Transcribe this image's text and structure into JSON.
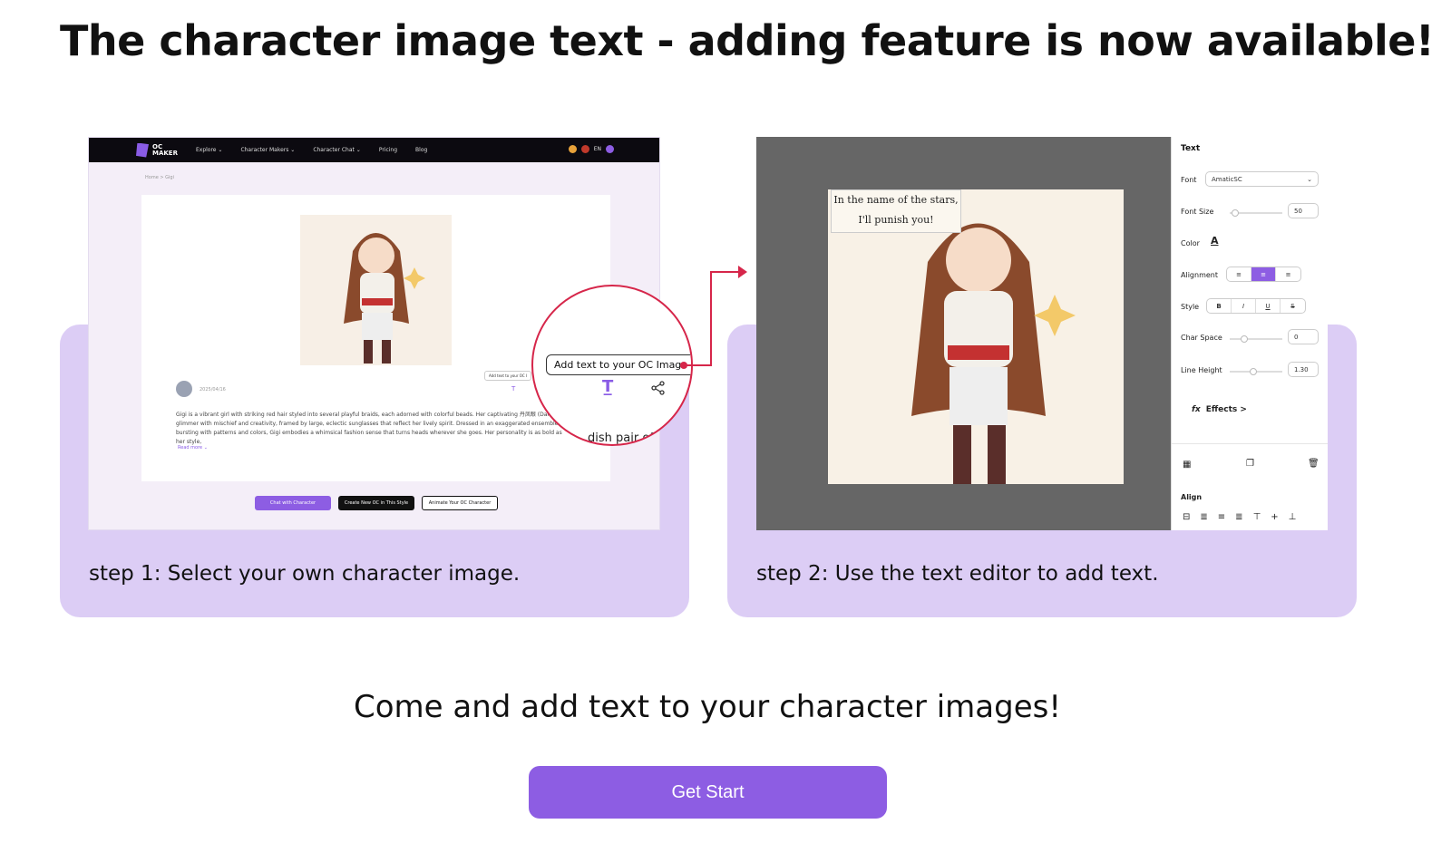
{
  "headline": "The character image text - adding feature is now available!",
  "steps": [
    {
      "caption": "step 1: Select your own character image."
    },
    {
      "caption": "step 2: Use the text editor to add text."
    }
  ],
  "site": {
    "logo": "OC\nMAKER",
    "nav": [
      "Explore ⌄",
      "Character Makers ⌄",
      "Character Chat ⌄",
      "Pricing",
      "Blog"
    ],
    "lang": "EN",
    "breadcrumb": "Home  >  Gigi",
    "date": "2025/04/16",
    "bio": "Gigi is a vibrant girl with striking red hair styled into several playful braids, each adorned with colorful beads. Her captivating 丹凤眼 (Danfeng) glimmer with mischief and creativity, framed by large, eclectic sunglasses that reflect her lively spirit. Dressed in an exaggerated ensemble bursting with patterns and colors, Gigi embodies a whimsical fashion sense that turns heads wherever she goes. Her personality is as bold as her style,",
    "read_more": "Read more ⌄",
    "mini_pill": "Add text to your OC I",
    "buttons": [
      "Chat with Character",
      "Create New OC in This Style",
      "Animate Your OC Character"
    ]
  },
  "zoom": {
    "pill": "Add text to your OC Image",
    "peek": "dish pair of"
  },
  "editor": {
    "canvas_text": [
      "In the name of the stars,",
      "I'll punish you!"
    ],
    "panel_title": "Text",
    "font_label": "Font",
    "font_value": "AmaticSC",
    "font_size_label": "Font Size",
    "font_size_value": "50",
    "color_label": "Color",
    "color_glyph": "A",
    "alignment_label": "Alignment",
    "style_label": "Style",
    "style_buttons": [
      "B",
      "I",
      "U",
      "S"
    ],
    "char_space_label": "Char Space",
    "char_space_value": "0",
    "line_height_label": "Line Height",
    "line_height_value": "1.30",
    "effects_label": "Effects >",
    "effects_icon": "fx",
    "align_label": "Align"
  },
  "subline": "Come and add text to your character images!",
  "cta": "Get Start",
  "colors": {
    "accent": "#8d5de3",
    "card": "#dccdf5",
    "highlight_ring": "#d6264a"
  }
}
